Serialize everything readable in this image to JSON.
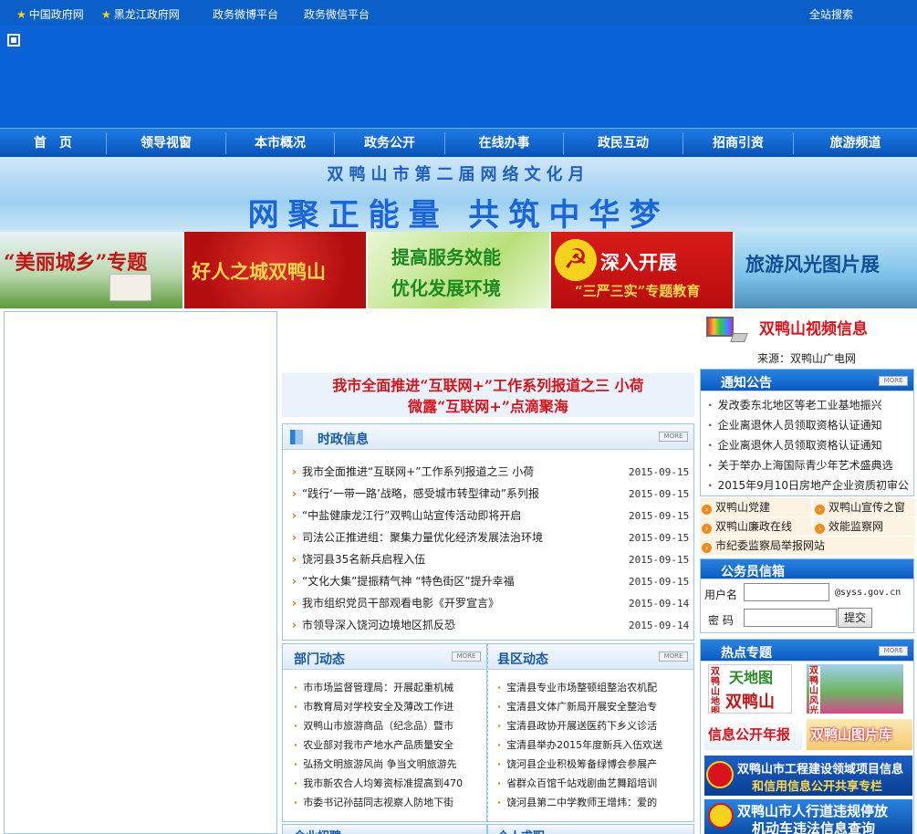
{
  "topbar": {
    "links": [
      "中国政府网",
      "黑龙江政府网",
      "政务微博平台",
      "政务微信平台"
    ],
    "search_label": "全站搜索"
  },
  "nav": [
    "首　页",
    "领导视窗",
    "本市概况",
    "政务公开",
    "在线办事",
    "政民互动",
    "招商引资",
    "旅游频道"
  ],
  "banner": {
    "line1": "双鸭山市第二届网络文化月",
    "line2": "网聚正能量 共筑中华梦"
  },
  "tiles": [
    {
      "text": "“美丽城乡”专题"
    },
    {
      "text": "好人之城双鸭山"
    },
    {
      "text": "提高服务效能",
      "text2": "优化发展环境"
    },
    {
      "text": "深入开展",
      "text2": "“三严三实”专题教育"
    },
    {
      "text": "旅游风光图片展"
    }
  ],
  "headline": {
    "line1": "我市全面推进“互联网+”工作系列报道之三 小荷",
    "line2": "微露“互联网+”点滴聚海"
  },
  "news": {
    "title": "时政信息",
    "more": "MORE",
    "items": [
      {
        "text": "我市全面推进“互联网+”工作系列报道之三 小荷",
        "date": "2015-09-15"
      },
      {
        "text": "“践行‘一带一路’战略，感受城市转型律动”系列报",
        "date": "2015-09-15"
      },
      {
        "text": "“中盐健康龙江行”双鸭山站宣传活动即将开启",
        "date": "2015-09-15"
      },
      {
        "text": "司法公正推进组：聚集力量优化经济发展法治环境",
        "date": "2015-09-15"
      },
      {
        "text": "饶河县35名新兵启程入伍",
        "date": "2015-09-15"
      },
      {
        "text": "“文化大集”提振精气神 “特色街区”提升幸福",
        "date": "2015-09-15"
      },
      {
        "text": "我市组织党员干部观看电影《开罗宣言》",
        "date": "2015-09-14"
      },
      {
        "text": "市领导深入饶河边境地区抓反恐",
        "date": "2015-09-14"
      }
    ]
  },
  "dept": {
    "title": "部门动态",
    "more": "MORE",
    "items": [
      "市市场监督管理局：开展起重机械",
      "市教育局对学校安全及薄改工作进",
      "双鸭山市旅游商品（纪念品）暨市",
      "农业部对我市产地水产品质量安全",
      "弘扬文明旅游风尚 争当文明旅游先",
      "我市新农合人均筹资标准提高到470",
      "市委书记孙喆同志视察人防地下街"
    ]
  },
  "county": {
    "title": "县区动态",
    "more": "MORE",
    "items": [
      "宝清县专业市场整顿组整治农机配",
      "宝清县文体广新局开展安全整治专",
      "宝清县政协开展送医药下乡义诊活",
      "宝清县举办2015年度新兵入伍欢送",
      "饶河县企业积极筹备绿博会参展产",
      "省群众百馆千站戏剧曲艺舞蹈培训",
      "饶河县第二中学教师王增炜：爱的"
    ]
  },
  "bottom_titles": [
    "企业招聘",
    "个人求职"
  ],
  "video": {
    "title": "双鸭山视频信息",
    "source": "来源：双鸭山广电网"
  },
  "notice": {
    "title": "通知公告",
    "more": "MORE",
    "items": [
      "发改委东北地区等老工业基地振兴",
      "企业离退休人员领取资格认证通知",
      "企业离退休人员领取资格认证通知",
      "关于举办上海国际青少年艺术盛典选",
      "2015年9月10日房地产企业资质初审公"
    ]
  },
  "quick_links": [
    "双鸭山党建",
    "双鸭山宣传之窗",
    "双鸭山廉政在线",
    "效能监察网",
    "市纪委监察局举报网站"
  ],
  "login": {
    "title": "公务员信箱",
    "user_label": "用户名",
    "pass_label": "密 码",
    "domain": "@syss.gov.cn",
    "submit": "提交"
  },
  "hot": {
    "title": "热点专题",
    "more": "MORE",
    "map_label": "双鸭山地图",
    "map_logo": "天地图",
    "map_city": "双鸭山",
    "scenery_label": "双鸭山风光",
    "info_annual": "信息公开年报",
    "photo_lib": "双鸭山图片库",
    "project_line1": "双鸭山市工程建设领域项目信息",
    "project_line2": "和信用信息公开共享专栏",
    "traffic_line1": "双鸭山市人行道违规停放",
    "traffic_line2": "机动车违法信息查询"
  },
  "colors": {
    "brand_blue": "#0b63d8",
    "headline_red": "#d8131b",
    "accent_orange": "#f08a1c"
  }
}
